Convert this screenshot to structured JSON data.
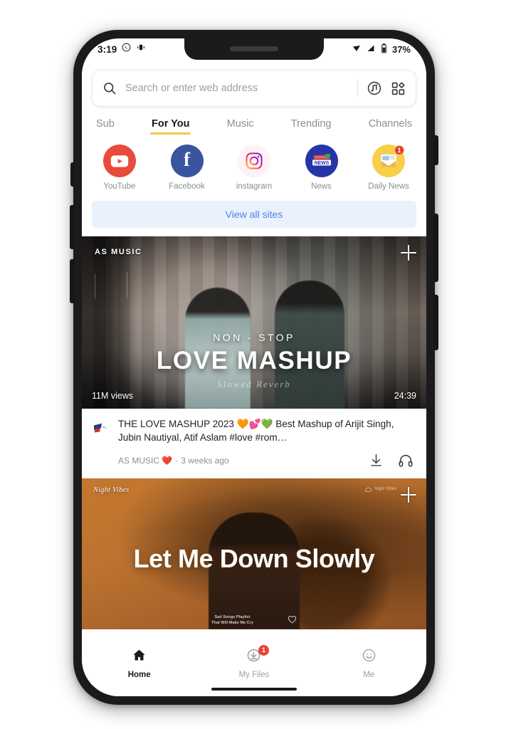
{
  "status_bar": {
    "time": "3:19",
    "battery_percent": "37%",
    "left_icons": [
      "whatsapp-icon",
      "vibrate-icon"
    ],
    "right_icons": [
      "wifi-icon",
      "signal-icon",
      "battery-icon"
    ]
  },
  "search": {
    "placeholder": "Search or enter web address",
    "value": "",
    "icons": [
      "search-icon",
      "music-note-icon",
      "apps-grid-icon"
    ]
  },
  "tabs": [
    {
      "label": "Sub",
      "active": false
    },
    {
      "label": "For You",
      "active": true
    },
    {
      "label": "Music",
      "active": false
    },
    {
      "label": "Trending",
      "active": false
    },
    {
      "label": "Channels",
      "active": false
    }
  ],
  "shortcuts": [
    {
      "label": "YouTube",
      "icon": "youtube-icon",
      "badge": ""
    },
    {
      "label": "Facebook",
      "icon": "facebook-icon",
      "badge": ""
    },
    {
      "label": "instagram",
      "icon": "instagram-icon",
      "badge": ""
    },
    {
      "label": "News",
      "icon": "news-icon",
      "badge": ""
    },
    {
      "label": "Daily News",
      "icon": "daily-news-icon",
      "badge": "1"
    }
  ],
  "view_all_sites": {
    "label": "View all sites"
  },
  "videos": [
    {
      "thumbnail": {
        "brand": "AS MUSIC",
        "overline": "NON - STOP",
        "title": "LOVE MASHUP",
        "script": "Slowed Reverb"
      },
      "views": "11M views",
      "duration": "24:39",
      "title": "THE LOVE MASHUP 2023 🧡💕💚 Best Mashup of Arijit Singh, Jubin Nautiyal, Atif Aslam #love #rom…",
      "channel": "AS MUSIC ❤️",
      "published": "3 weeks ago",
      "separator": "·",
      "actions": [
        "download-icon",
        "headphones-icon"
      ],
      "add_button": "add-icon"
    },
    {
      "thumbnail": {
        "brand": "Night Vibes",
        "title": "Let Me Down Slowly",
        "watermark": "Night Vibes",
        "playlist_line1": "Sad Songs Playlist",
        "playlist_line2": "That Will Make Me Cry"
      },
      "add_button": "add-icon"
    }
  ],
  "bottom_nav": [
    {
      "label": "Home",
      "icon": "home-icon",
      "active": true,
      "badge": ""
    },
    {
      "label": "My Files",
      "icon": "downloads-icon",
      "active": false,
      "badge": "1"
    },
    {
      "label": "Me",
      "icon": "profile-icon",
      "active": false,
      "badge": ""
    }
  ],
  "colors": {
    "accent_tab": "#f2c94c",
    "link_blue": "#4a86e8",
    "badge_red": "#ea4335",
    "youtube_red": "#e84b3c",
    "facebook_blue": "#3a559f",
    "news_blue": "#2435a8",
    "daily_news_yellow": "#f7cf49"
  }
}
